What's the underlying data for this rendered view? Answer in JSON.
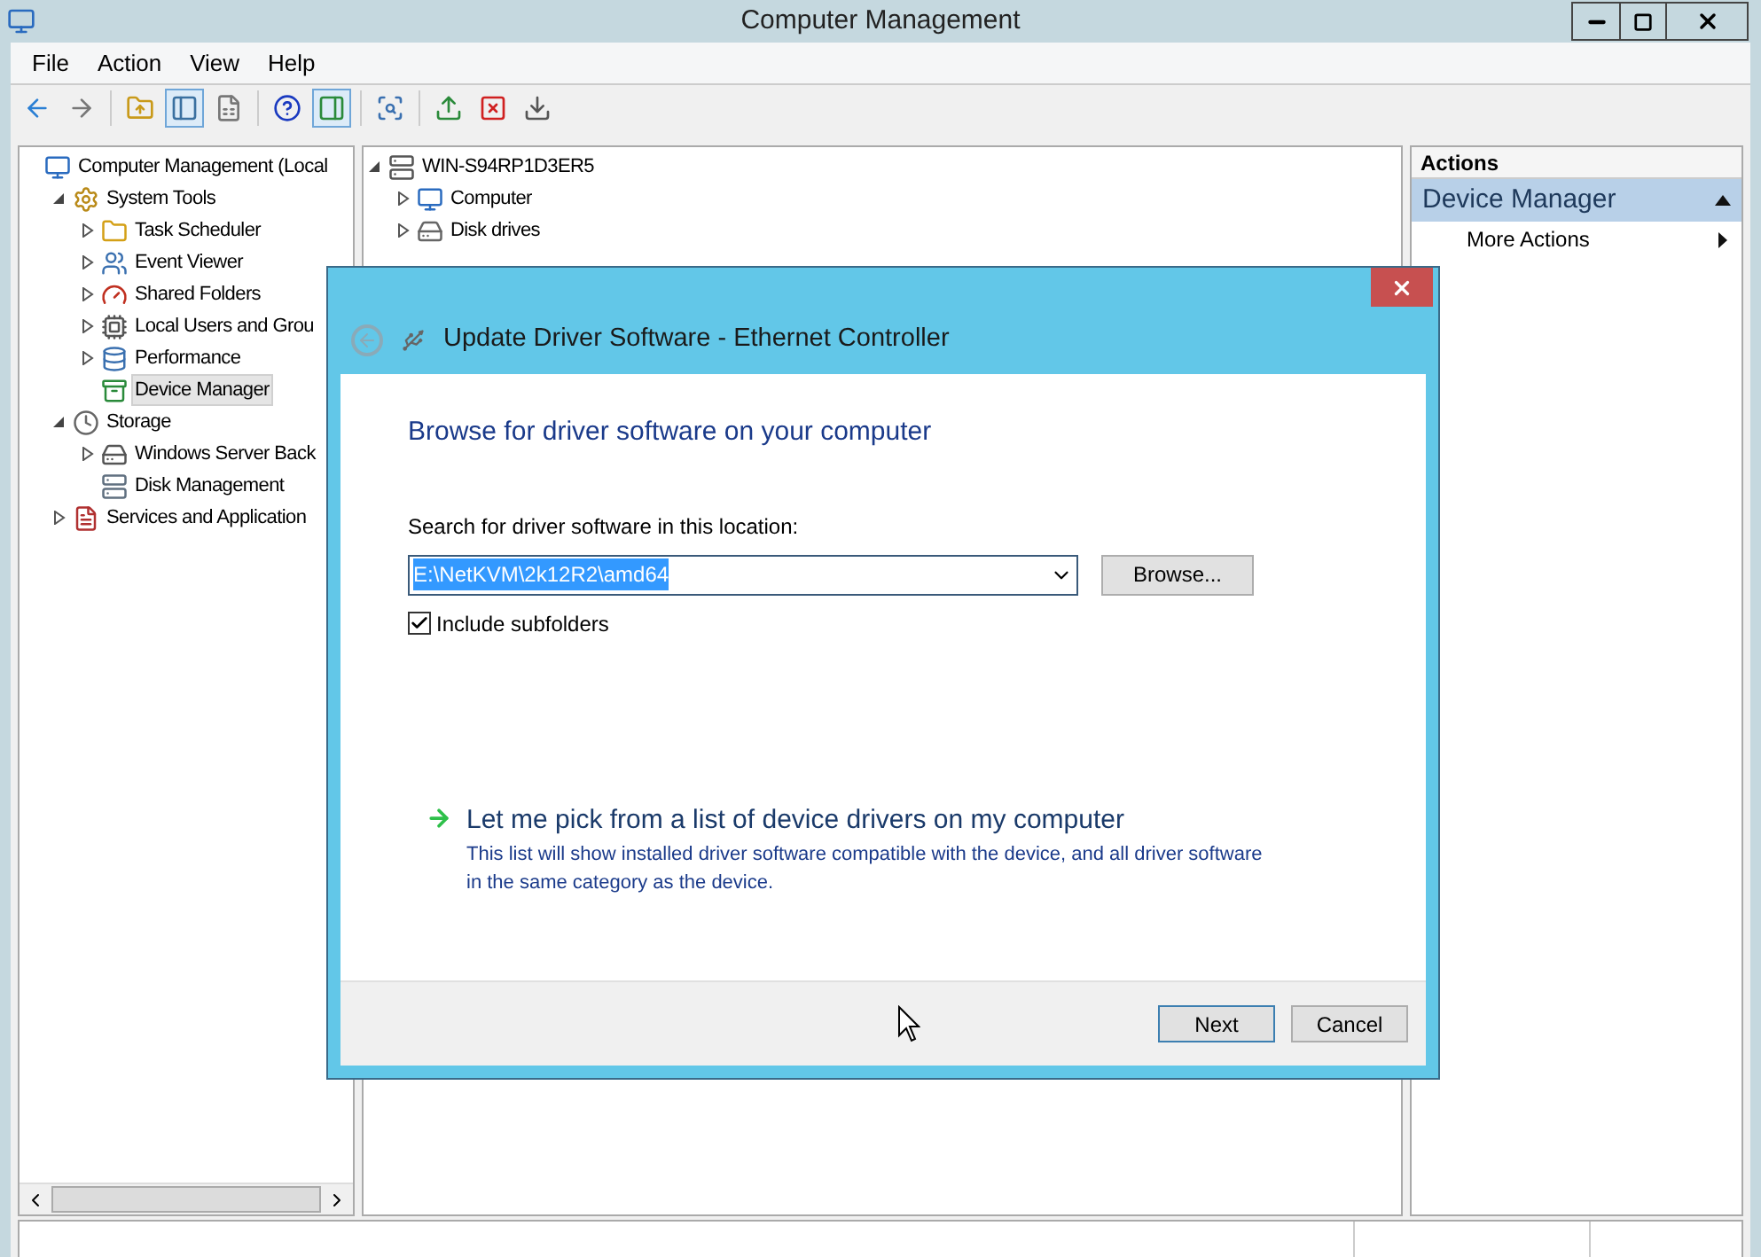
{
  "window": {
    "title": "Computer Management"
  },
  "menu": [
    "File",
    "Action",
    "View",
    "Help"
  ],
  "toolbar": [
    {
      "pressed": false
    },
    {
      "pressed": false
    },
    {
      "pressed": false
    },
    {
      "pressed": true
    },
    {
      "pressed": false
    },
    {
      "pressed": false
    },
    {
      "pressed": true
    },
    {
      "pressed": false
    },
    {
      "pressed": false
    },
    {
      "pressed": false
    },
    {
      "pressed": false
    }
  ],
  "nav_tree": [
    {
      "label": "Computer Management (Local",
      "selected": false,
      "children": [
        {
          "label": "System Tools",
          "expanded": true,
          "selected": false,
          "children": [
            {
              "label": "Task Scheduler",
              "expanded": false,
              "selected": false
            },
            {
              "label": "Event Viewer",
              "expanded": false,
              "selected": false
            },
            {
              "label": "Shared Folders",
              "expanded": false,
              "selected": false
            },
            {
              "label": "Local Users and Grou",
              "expanded": false,
              "selected": false
            },
            {
              "label": "Performance",
              "expanded": false,
              "selected": false
            },
            {
              "label": "Device Manager",
              "selected": true
            }
          ]
        },
        {
          "label": "Storage",
          "expanded": true,
          "selected": false,
          "children": [
            {
              "label": "Windows Server Back",
              "expanded": false,
              "selected": false
            },
            {
              "label": "Disk Management",
              "selected": false
            }
          ]
        },
        {
          "label": "Services and Application",
          "expanded": false,
          "selected": false
        }
      ]
    }
  ],
  "device_tree": [
    {
      "label": "WIN-S94RP1D3ER5",
      "expanded": true,
      "children": [
        {
          "label": "Computer",
          "expanded": false
        },
        {
          "label": "Disk drives",
          "expanded": false
        }
      ]
    }
  ],
  "actions": {
    "header": "Actions",
    "section": "Device Manager",
    "items": [
      "More Actions"
    ]
  },
  "dialog": {
    "title": "Update Driver Software - Ethernet Controller",
    "heading": "Browse for driver software on your computer",
    "location_label": "Search for driver software in this location:",
    "location_value": "E:\\NetKVM\\2k12R2\\amd64",
    "browse": "Browse...",
    "include_subfolders": {
      "label": "Include subfolders",
      "checked": true
    },
    "pick_link": "Let me pick from a list of device drivers on my computer",
    "pick_description": "This list will show installed driver software compatible with the device, and all driver software in the same category as the device.",
    "buttons": [
      {
        "label": "Next",
        "default": true
      },
      {
        "label": "Cancel",
        "default": false
      }
    ]
  }
}
